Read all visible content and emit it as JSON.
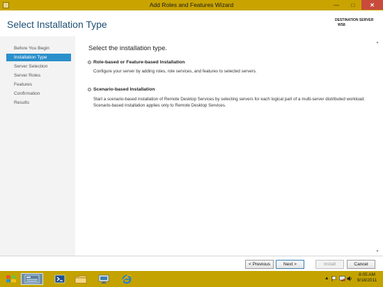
{
  "window": {
    "title": "Add Roles and Features Wizard",
    "minimize_glyph": "—",
    "maximize_glyph": "□",
    "close_glyph": "✕"
  },
  "header": {
    "page_title": "Select Installation Type",
    "destination_label": "DESTINATION SERVER",
    "destination_server": "WS8"
  },
  "sidebar": {
    "items": [
      {
        "label": "Before You Begin",
        "active": false
      },
      {
        "label": "Installation Type",
        "active": true
      },
      {
        "label": "Server Selection",
        "active": false
      },
      {
        "label": "Server Roles",
        "active": false
      },
      {
        "label": "Features",
        "active": false
      },
      {
        "label": "Confirmation",
        "active": false
      },
      {
        "label": "Results",
        "active": false
      }
    ]
  },
  "main": {
    "heading": "Select the installation type.",
    "options": [
      {
        "label": "Role-based or Feature-based Installation",
        "selected": true,
        "description": "Configure your server by adding roles, role services, and features to selected servers."
      },
      {
        "label": "Scenario-based Installation",
        "selected": false,
        "description": "Start a scenario-based installation of Remote Desktop Services by selecting servers for each logical part of a multi-server distributed workload. Scenario-based installation applies only to Remote Desktop Services."
      }
    ]
  },
  "footer": {
    "previous_label": "< Previous",
    "next_label": "Next >",
    "install_label": "Install",
    "cancel_label": "Cancel"
  },
  "taskbar": {
    "icons": [
      "windows-start-icon",
      "server-manager-icon",
      "powershell-icon",
      "explorer-folder-icon",
      "remote-desktop-icon",
      "internet-explorer-icon"
    ],
    "clock_time": "8:05 AM",
    "clock_date": "9/18/2011"
  },
  "colors": {
    "title_bar": "#c9a400",
    "accent": "#2b8fcb",
    "close_button": "#c94b3c",
    "page_title": "#1d4f75"
  }
}
